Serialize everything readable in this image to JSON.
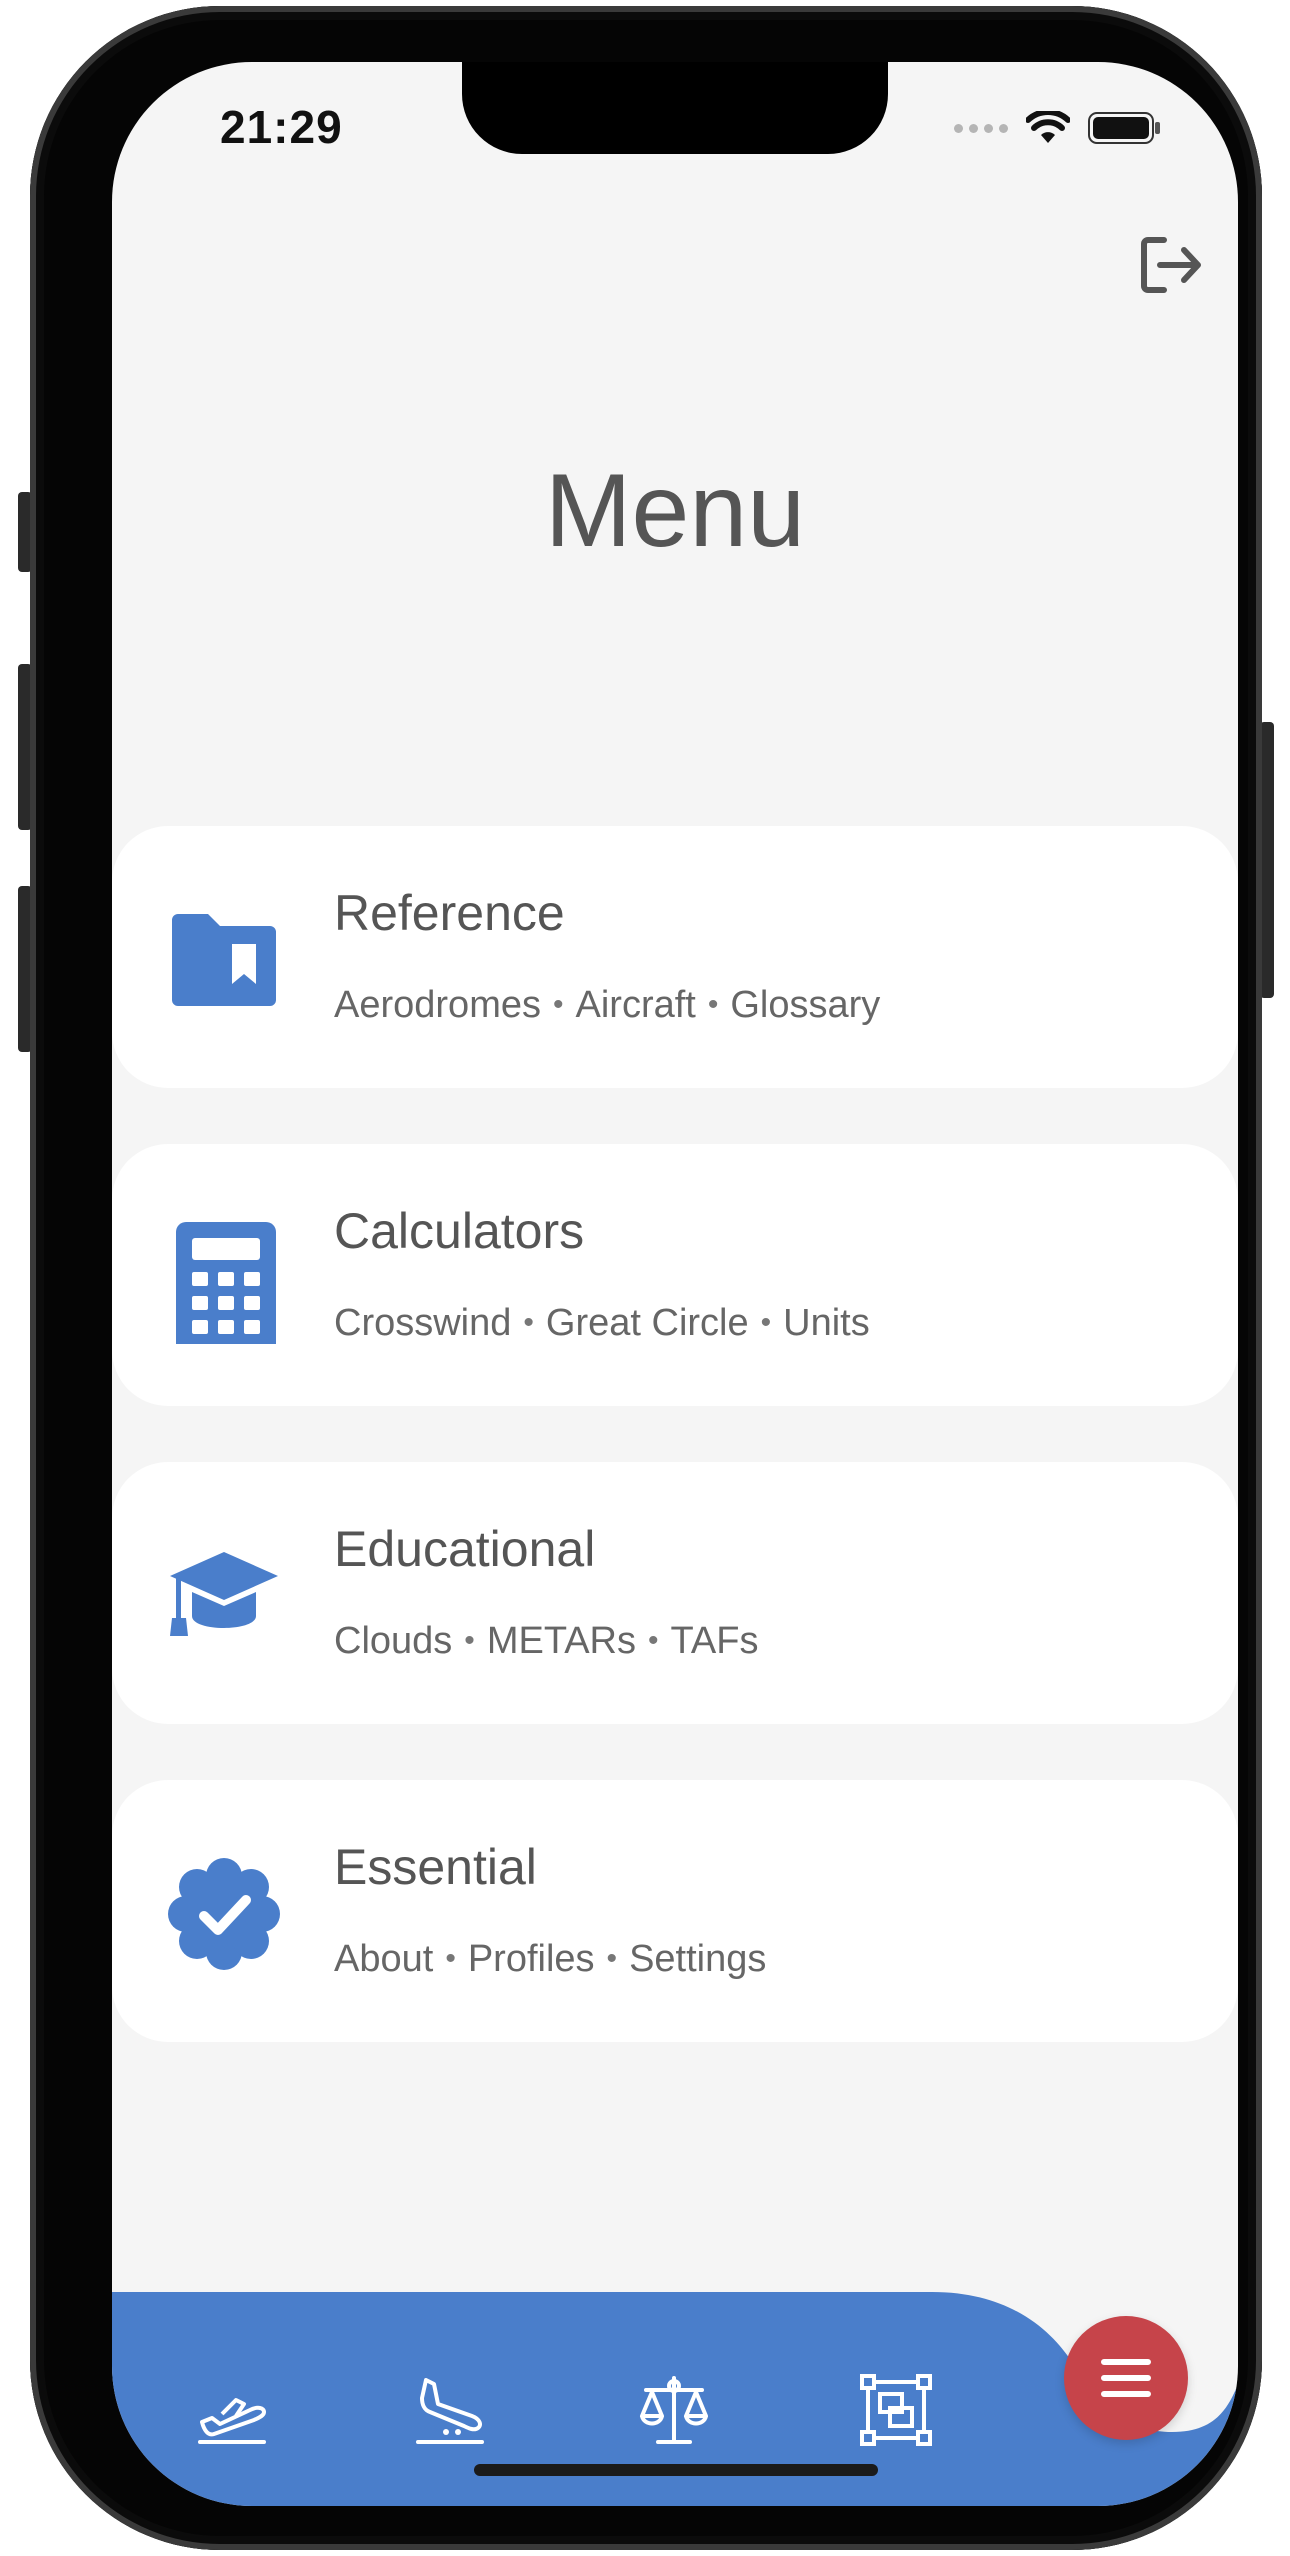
{
  "status_bar": {
    "time": "21:29"
  },
  "header": {
    "title": "Menu"
  },
  "menu_cards": [
    {
      "title": "Reference",
      "items": [
        "Aerodromes",
        "Aircraft",
        "Glossary"
      ],
      "icon": "folder-bookmark-icon"
    },
    {
      "title": "Calculators",
      "items": [
        "Crosswind",
        "Great Circle",
        "Units"
      ],
      "icon": "calculator-icon"
    },
    {
      "title": "Educational",
      "items": [
        "Clouds",
        "METARs",
        "TAFs"
      ],
      "icon": "graduation-cap-icon"
    },
    {
      "title": "Essential",
      "items": [
        "About",
        "Profiles",
        "Settings"
      ],
      "icon": "verified-badge-icon"
    }
  ],
  "bottom_nav": {
    "items": [
      "takeoff-icon",
      "landing-icon",
      "scale-icon",
      "route-map-icon"
    ],
    "fab_icon": "menu-icon"
  },
  "colors": {
    "accent": "#4a7ecb",
    "fab": "#c6444a",
    "background": "#f5f5f5",
    "card": "#ffffff",
    "text": "#555555"
  }
}
